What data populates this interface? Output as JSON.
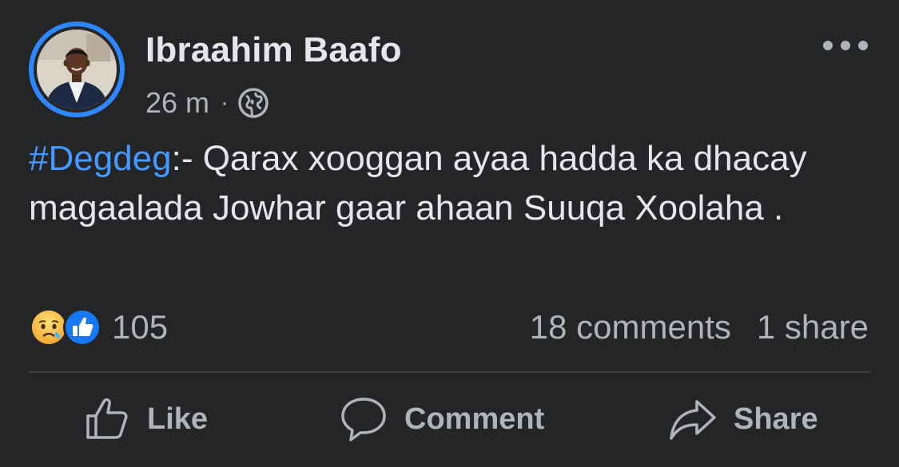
{
  "author": {
    "name": "Ibraahim Baafo",
    "time": "26 m",
    "separator": "·",
    "privacy_icon": "globe-icon",
    "avatar_ring_color": "#2d88ff"
  },
  "post": {
    "hashtag": "#Degdeg",
    "text": ":- Qarax xooggan ayaa hadda ka dhacay magaalada Jowhar gaar ahaan Suuqa Xoolaha ."
  },
  "stats": {
    "reaction_icons": [
      "sad-reaction-icon",
      "like-reaction-icon"
    ],
    "reaction_count": "105",
    "comments": "18 comments",
    "shares": "1 share"
  },
  "actions": {
    "like": "Like",
    "comment": "Comment",
    "share": "Share"
  },
  "colors": {
    "background": "#242526",
    "primary_text": "#e4e6eb",
    "secondary_text": "#b0b3b8",
    "link": "#4599ff",
    "divider": "#3e4042"
  }
}
